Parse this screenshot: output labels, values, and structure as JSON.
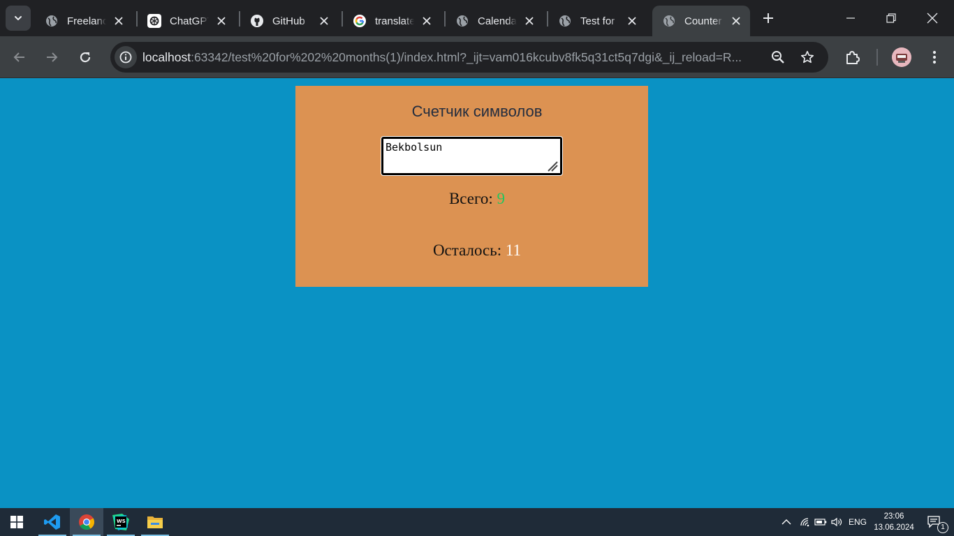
{
  "browser": {
    "tabs": [
      {
        "title": "Freelance",
        "favicon": "globe-icon",
        "active": false
      },
      {
        "title": "ChatGPT",
        "favicon": "chatgpt-icon",
        "active": false
      },
      {
        "title": "GitHub",
        "favicon": "github-icon",
        "active": false
      },
      {
        "title": "translate",
        "favicon": "google-icon",
        "active": false
      },
      {
        "title": "Calendar",
        "favicon": "globe-icon",
        "active": false
      },
      {
        "title": "Test for",
        "favicon": "globe-icon",
        "active": false
      },
      {
        "title": "Counter",
        "favicon": "globe-icon",
        "active": true
      }
    ],
    "url_host": "localhost",
    "url_rest": ":63342/test%20for%202%20months(1)/index.html?_ijt=vam016kcubv8fk5q31ct5q7dgi&_ij_reload=R..."
  },
  "page": {
    "background_color": "#0a92c4",
    "card_color": "#dc9252",
    "title": "Счетчик символов",
    "textarea_value": "Bekbolsun",
    "total_label": "Всего: ",
    "total_value": "9",
    "remaining_label": "Осталось: ",
    "remaining_value": "11"
  },
  "taskbar": {
    "apps": [
      "start-icon",
      "vscode-icon",
      "chrome-icon",
      "webstorm-icon",
      "file-explorer-icon"
    ],
    "language": "ENG",
    "time": "23:06",
    "date": "13.06.2024",
    "notification_count": "1"
  }
}
